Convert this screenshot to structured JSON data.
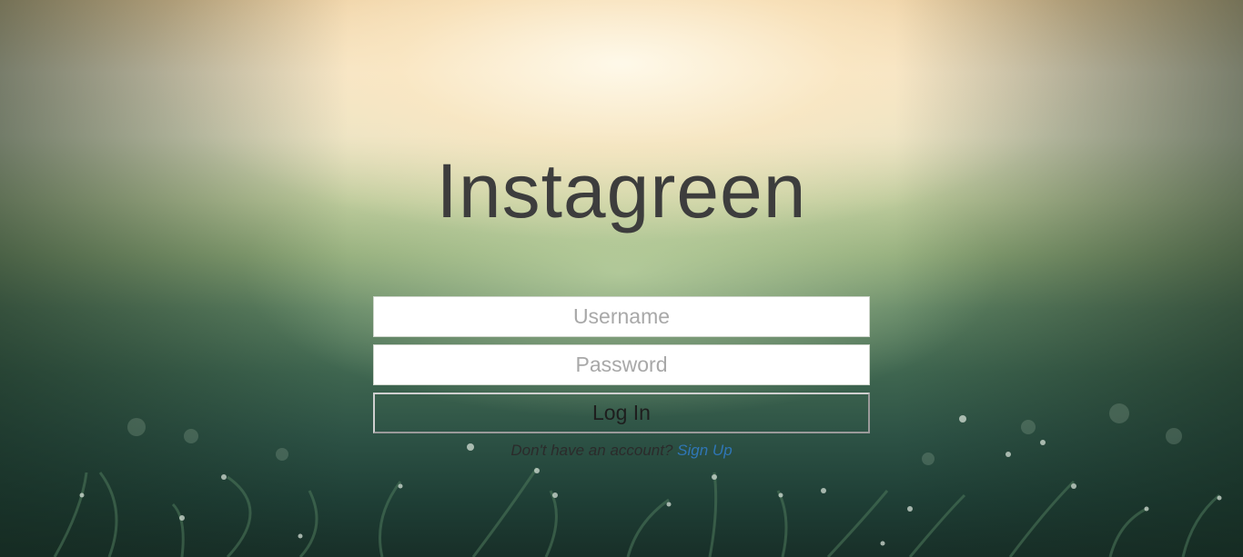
{
  "app": {
    "title": "Instagreen"
  },
  "login_form": {
    "username_placeholder": "Username",
    "username_value": "",
    "password_placeholder": "Password",
    "password_value": "",
    "login_label": "Log In",
    "signup_prompt": "Don't have an account?",
    "signup_link_label": "Sign Up"
  },
  "colors": {
    "title_text": "#3d3d3d",
    "link": "#2f76b6",
    "field_bg": "#ffffff"
  }
}
